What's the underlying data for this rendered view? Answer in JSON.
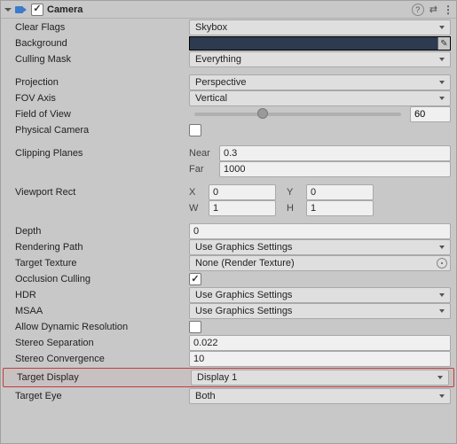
{
  "header": {
    "title": "Camera"
  },
  "labels": {
    "clearFlags": "Clear Flags",
    "background": "Background",
    "cullingMask": "Culling Mask",
    "projection": "Projection",
    "fovAxis": "FOV Axis",
    "fov": "Field of View",
    "physicalCamera": "Physical Camera",
    "clippingPlanes": "Clipping Planes",
    "near": "Near",
    "far": "Far",
    "viewportRect": "Viewport Rect",
    "x": "X",
    "y": "Y",
    "w": "W",
    "h": "H",
    "depth": "Depth",
    "renderingPath": "Rendering Path",
    "targetTexture": "Target Texture",
    "occlusionCulling": "Occlusion Culling",
    "hdr": "HDR",
    "msaa": "MSAA",
    "allowDynamicRes": "Allow Dynamic Resolution",
    "stereoSeparation": "Stereo Separation",
    "stereoConvergence": "Stereo Convergence",
    "targetDisplay": "Target Display",
    "targetEye": "Target Eye"
  },
  "values": {
    "clearFlags": "Skybox",
    "backgroundColor": "#2e3a50",
    "cullingMask": "Everything",
    "projection": "Perspective",
    "fovAxis": "Vertical",
    "fov": "60",
    "near": "0.3",
    "far": "1000",
    "vpX": "0",
    "vpY": "0",
    "vpW": "1",
    "vpH": "1",
    "depth": "0",
    "renderingPath": "Use Graphics Settings",
    "targetTexture": "None (Render Texture)",
    "hdr": "Use Graphics Settings",
    "msaa": "Use Graphics Settings",
    "stereoSeparation": "0.022",
    "stereoConvergence": "10",
    "targetDisplay": "Display 1",
    "targetEye": "Both"
  },
  "toggles": {
    "enabled": true,
    "physicalCamera": false,
    "occlusionCulling": true,
    "allowDynamicRes": false
  }
}
